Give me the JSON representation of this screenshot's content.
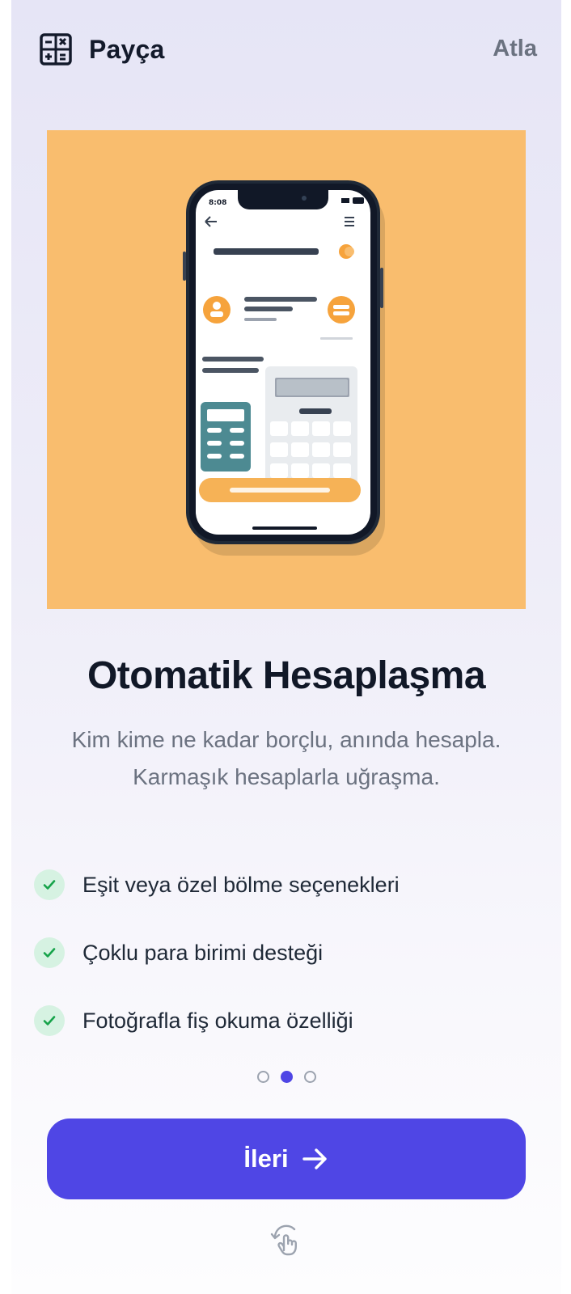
{
  "header": {
    "app_name": "Payça",
    "skip_label": "Atla",
    "logo_icon": "calculator-icon"
  },
  "hero": {
    "illustration": "phone-calculator-illustration",
    "background_color": "#f9bd6e"
  },
  "content": {
    "title": "Otomatik Hesaplaşma",
    "subtitle_line1": "Kim kime ne kadar borçlu, anında hesapla.",
    "subtitle_line2": "Karmaşık hesaplarla uğraşma."
  },
  "features": [
    {
      "label": "Eşit veya özel bölme seçenekleri",
      "icon": "check-icon"
    },
    {
      "label": "Çoklu para birimi desteği",
      "icon": "check-icon"
    },
    {
      "label": "Fotoğrafla fiş okuma özelliği",
      "icon": "check-icon"
    }
  ],
  "pager": {
    "total": 3,
    "current": 2
  },
  "next_button": {
    "label": "İleri",
    "icon": "arrow-right-icon"
  },
  "gesture_hint": {
    "icon": "swipe-hand-icon"
  },
  "colors": {
    "accent": "#4f46e5",
    "check_bg": "#d6f2e2",
    "check": "#16a34a"
  }
}
